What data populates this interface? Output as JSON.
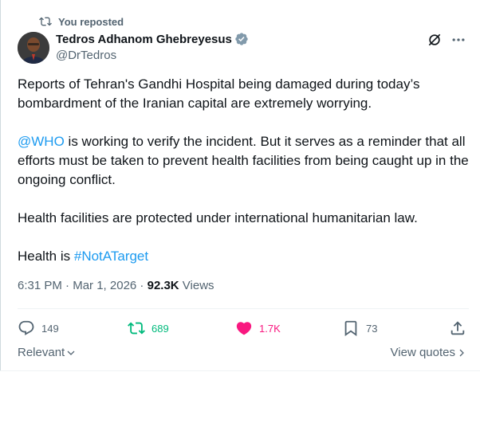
{
  "repost_banner": {
    "label": "You reposted"
  },
  "author": {
    "name": "Tedros Adhanom Ghebreyesus",
    "handle": "@DrTedros",
    "verified": true
  },
  "tweet": {
    "p1": "Reports of Tehran's Gandhi Hospital being damaged during today’s bombardment of the Iranian capital are extremely worrying.",
    "p2_mention": "@WHO",
    "p2_rest": " is working to verify the incident. But it serves as a reminder that all efforts must be taken to prevent health facilities from being caught up in the ongoing conflict.",
    "p3": "Health facilities are protected under international humanitarian law.",
    "p4_prefix": "Health is ",
    "p4_hashtag": "#NotATarget"
  },
  "meta": {
    "time": "6:31 PM",
    "separator": " · ",
    "date": "Mar 1, 2026",
    "views_count": "92.3K",
    "views_label": " Views"
  },
  "engagement": {
    "replies": "149",
    "reposts": "689",
    "likes": "1.7K",
    "bookmarks": "73"
  },
  "footer": {
    "relevant_label": "Relevant",
    "view_quotes_label": "View quotes"
  },
  "colors": {
    "accent": "#1d9bf0",
    "repost_active": "#00ba7c",
    "like_active": "#f91880",
    "muted": "#536471"
  }
}
